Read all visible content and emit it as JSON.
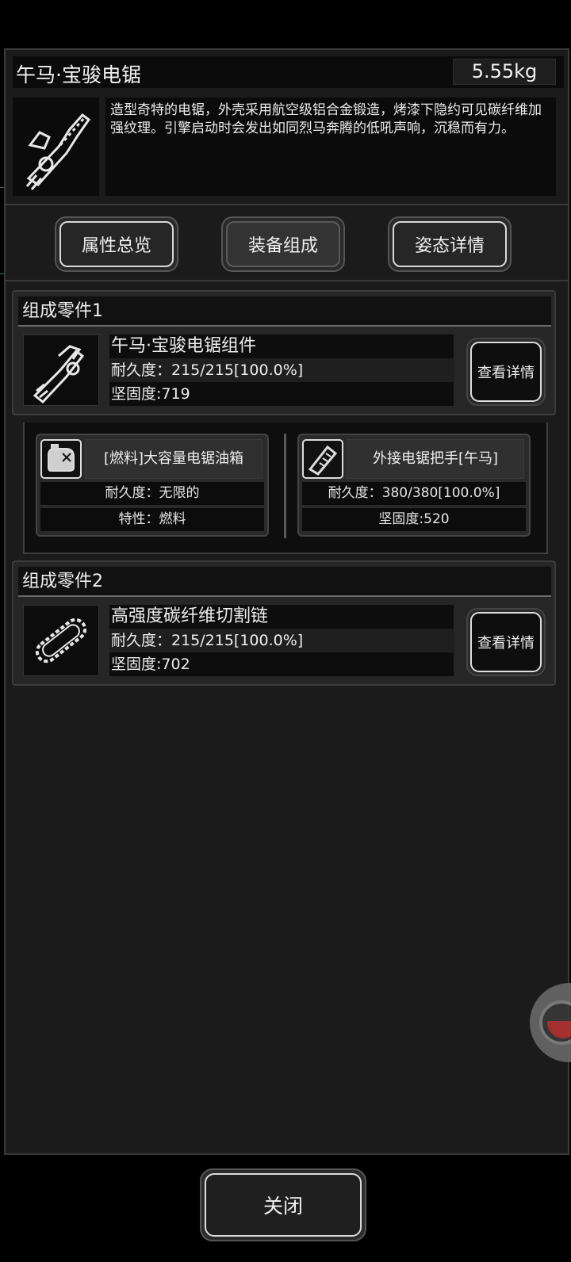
{
  "item": {
    "title": "午马·宝骏电锯",
    "weight": "5.55kg",
    "description": "造型奇特的电锯，外壳采用航空级铝合金锻造，烤漆下隐约可见碳纤维加强纹理。引擎启动时会发出如同烈马奔腾的低吼声响，沉稳而有力。",
    "icon": "chainsaw-icon"
  },
  "tabs": [
    {
      "label": "属性总览",
      "active": false
    },
    {
      "label": "装备组成",
      "active": true
    },
    {
      "label": "姿态详情",
      "active": false
    }
  ],
  "components": [
    {
      "header": "组成零件1",
      "name": "午马·宝骏电锯组件",
      "durability": "耐久度：215/215[100.0%]",
      "hardness": "坚固度:719",
      "detail_label": "查看详情",
      "icon": "chainsaw-body-icon",
      "subparts": [
        {
          "title": "[燃料]大容量电锯油箱",
          "row1": "耐久度：无限的",
          "row2": "特性：燃料",
          "icon": "fuel-tank-icon"
        },
        {
          "title": "外接电锯把手[午马]",
          "row1": "耐久度：380/380[100.0%]",
          "row2": "坚固度:520",
          "icon": "handle-icon"
        }
      ]
    },
    {
      "header": "组成零件2",
      "name": "高强度碳纤维切割链",
      "durability": "耐久度：215/215[100.0%]",
      "hardness": "坚固度:702",
      "detail_label": "查看详情",
      "icon": "chain-blade-icon"
    }
  ],
  "close_label": "关闭"
}
